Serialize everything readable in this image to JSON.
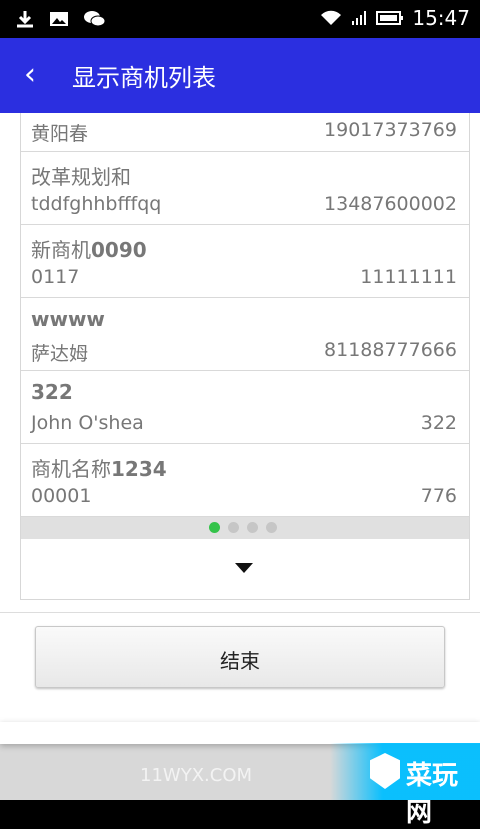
{
  "statusbar": {
    "time": "15:47",
    "icons": [
      "download-icon",
      "image-icon",
      "wechat-icon",
      "wifi-icon",
      "signal-icon",
      "battery-icon"
    ]
  },
  "header": {
    "title": "显示商机列表",
    "back_icon": "chevron-left-icon",
    "color": "#2b2fe0"
  },
  "list": {
    "partial_top": {
      "left": "黄阳春",
      "right": "19017373769"
    },
    "items": [
      {
        "name": "改革规划和",
        "name_bold": "",
        "left": "tddfghhbfffqq",
        "right": "13487600002"
      },
      {
        "name": "新商机",
        "name_bold": "0090",
        "left": "0117",
        "right": "11111111"
      },
      {
        "name": "",
        "name_bold": "wwww",
        "left": "萨达姆",
        "right": "81188777666"
      },
      {
        "name": "",
        "name_bold": "322",
        "left": "John O'shea",
        "right": "322"
      },
      {
        "name": "商机名称",
        "name_bold": "1234",
        "left": "00001",
        "right": "776"
      }
    ],
    "pager": {
      "pages": 4,
      "active": 1,
      "active_color": "#34c34a"
    },
    "expand_icon": "chevron-down-icon"
  },
  "actions": {
    "finish_label": "结束"
  },
  "watermark": {
    "text": "11WYX.COM",
    "logo": "菜玩网"
  }
}
